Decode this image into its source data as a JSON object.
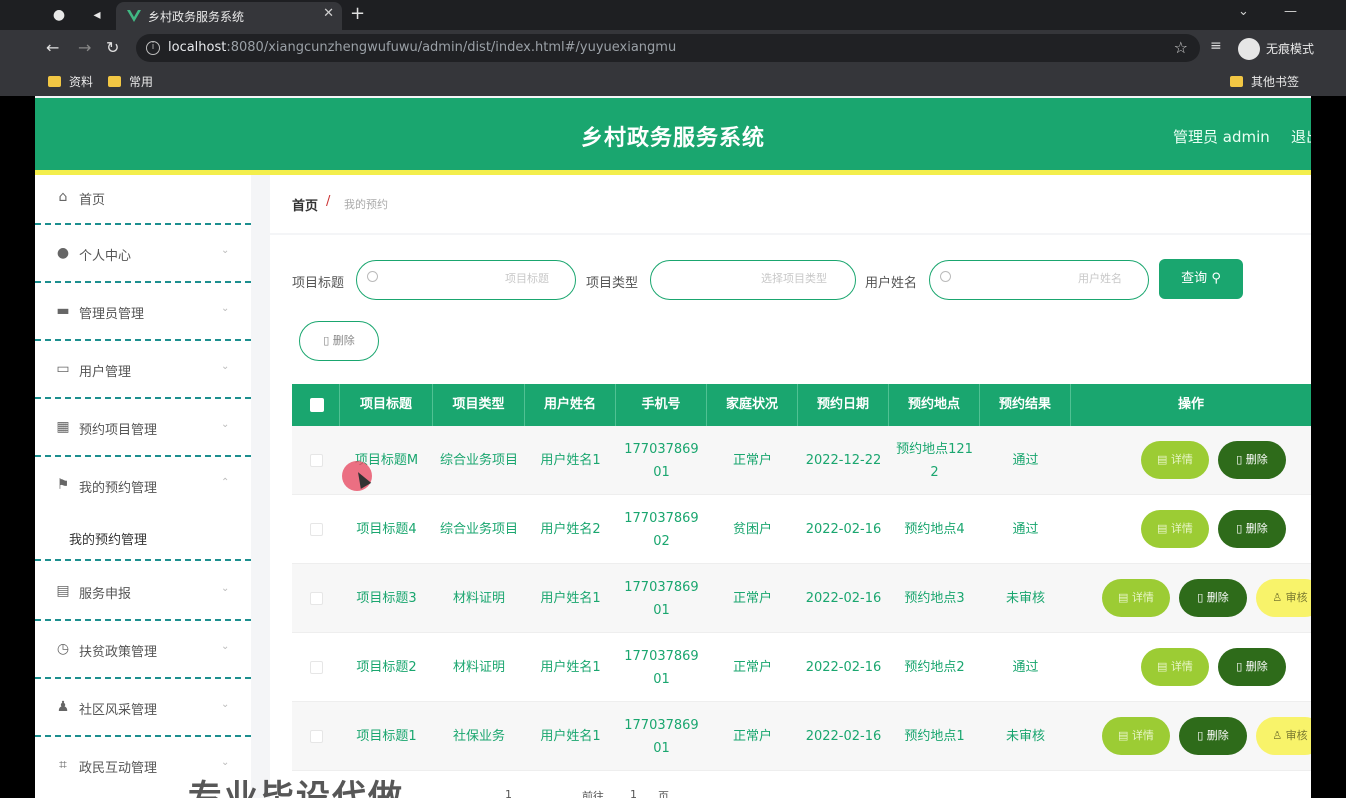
{
  "browser": {
    "tab_title": "乡村政务服务系统",
    "url_host": "localhost",
    "url_rest": ":8080/xiangcunzhengwufuwu/admin/dist/index.html#/yuyuexiangmu",
    "incognito_label": "无痕模式",
    "bookmarks": [
      "资料",
      "常用"
    ],
    "other_bookmarks": "其他书签"
  },
  "header": {
    "title": "乡村政务服务系统",
    "user": "管理员 admin",
    "logout": "退出"
  },
  "sidebar": {
    "items": [
      {
        "label": "首页",
        "icon": "home-icon"
      },
      {
        "label": "个人中心",
        "icon": "user-icon"
      },
      {
        "label": "管理员管理",
        "icon": "admin-icon"
      },
      {
        "label": "用户管理",
        "icon": "users-icon"
      },
      {
        "label": "预约项目管理",
        "icon": "grid-icon"
      },
      {
        "label": "我的预约管理",
        "icon": "flag-icon"
      },
      {
        "label": "服务申报",
        "icon": "doc-icon"
      },
      {
        "label": "扶贫政策管理",
        "icon": "clock-icon"
      },
      {
        "label": "社区风采管理",
        "icon": "person-icon"
      },
      {
        "label": "政民互动管理",
        "icon": "crop-icon"
      }
    ],
    "submenu_label": "我的预约管理"
  },
  "breadcrumb": {
    "home": "首页",
    "separator": "/",
    "current": "我的预约"
  },
  "filters": {
    "title_label": "项目标题",
    "title_placeholder": "项目标题",
    "type_label": "项目类型",
    "type_placeholder": "选择项目类型",
    "name_label": "用户姓名",
    "name_placeholder": "用户姓名",
    "search_label": "查询",
    "delete_label": "删除"
  },
  "table": {
    "headers": [
      "项目标题",
      "项目类型",
      "用户姓名",
      "手机号",
      "家庭状况",
      "预约日期",
      "预约地点",
      "预约结果",
      "操作"
    ],
    "rows": [
      {
        "title": "项目标题M",
        "type": "综合业务项目",
        "name": "用户姓名1",
        "phone": "17703786901",
        "family": "正常户",
        "date": "2022-12-22",
        "place": "预约地点1212",
        "result": "通过",
        "ops": [
          "详情",
          "删除"
        ]
      },
      {
        "title": "项目标题4",
        "type": "综合业务项目",
        "name": "用户姓名2",
        "phone": "17703786902",
        "family": "贫困户",
        "date": "2022-02-16",
        "place": "预约地点4",
        "result": "通过",
        "ops": [
          "详情",
          "删除"
        ]
      },
      {
        "title": "项目标题3",
        "type": "材料证明",
        "name": "用户姓名1",
        "phone": "17703786901",
        "family": "正常户",
        "date": "2022-02-16",
        "place": "预约地点3",
        "result": "未审核",
        "ops": [
          "详情",
          "删除",
          "审核"
        ]
      },
      {
        "title": "项目标题2",
        "type": "材料证明",
        "name": "用户姓名1",
        "phone": "17703786901",
        "family": "正常户",
        "date": "2022-02-16",
        "place": "预约地点2",
        "result": "通过",
        "ops": [
          "详情",
          "删除"
        ]
      },
      {
        "title": "项目标题1",
        "type": "社保业务",
        "name": "用户姓名1",
        "phone": "17703786901",
        "family": "正常户",
        "date": "2022-02-16",
        "place": "预约地点1",
        "result": "未审核",
        "ops": [
          "详情",
          "删除",
          "审核"
        ]
      }
    ]
  },
  "watermark": "专业毕设代做",
  "pager": [
    "1",
    "前往",
    "1",
    "页"
  ],
  "colors": {
    "primary": "#1aa66f",
    "accent_line": "#f3ee4c",
    "detail_btn": "#9ccc34",
    "delete_btn": "#2e6b1a",
    "audit_btn": "#f8f36a"
  }
}
